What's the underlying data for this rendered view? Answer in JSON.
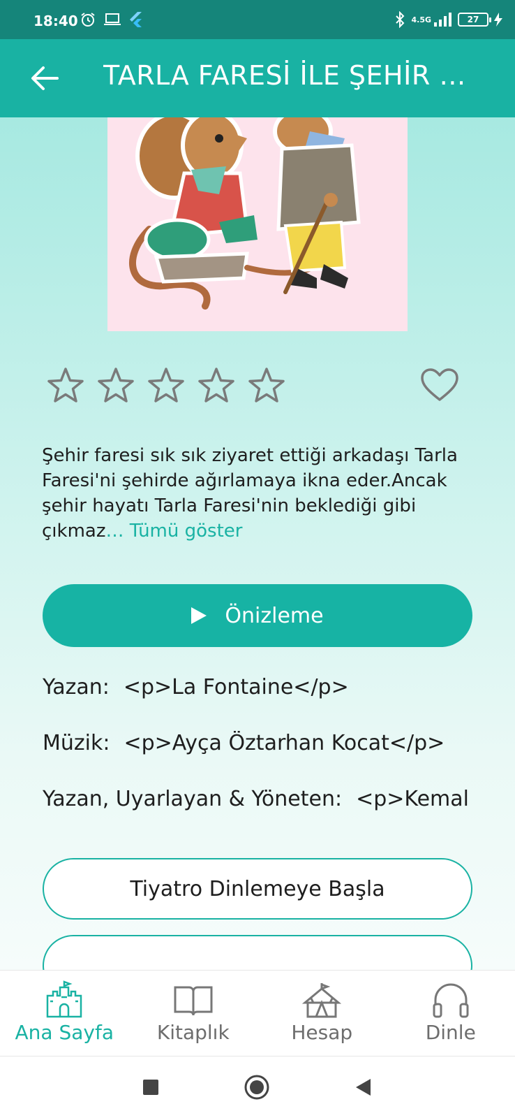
{
  "status_bar": {
    "time": "18:40",
    "battery": "27",
    "network": "4.5G"
  },
  "app_bar": {
    "title": "TARLA FARESİ İLE ŞEHİR …"
  },
  "book": {
    "rating": 0,
    "rating_max": 5,
    "favorited": false,
    "description": "Şehir faresi sık sık ziyaret ettiği arkadaşı Tarla Faresi'ni şehirde ağırlamaya ikna eder.Ancak şehir hayatı Tarla Faresi'nin beklediği gibi çıkmaz",
    "show_more": "… Tümü göster",
    "preview_label": "Önizleme",
    "credits": [
      {
        "label": "Yazan:",
        "value": "<p>La Fontaine</p>"
      },
      {
        "label": "Müzik:",
        "value": "<p>Ayça Öztarhan Kocat</p>"
      },
      {
        "label": "Yazan, Uyarlayan & Yöneten:",
        "value": "<p>Kemal Kc"
      }
    ],
    "listen_label": "Tiyatro Dinlemeye Başla"
  },
  "bottom_nav": {
    "items": [
      {
        "label": "Ana Sayfa",
        "icon": "castle-icon",
        "active": true
      },
      {
        "label": "Kitaplık",
        "icon": "book-icon",
        "active": false
      },
      {
        "label": "Hesap",
        "icon": "circus-tent-icon",
        "active": false
      },
      {
        "label": "Dinle",
        "icon": "headphones-icon",
        "active": false
      }
    ]
  },
  "colors": {
    "primary": "#19b2a3",
    "status_bar": "#15857a"
  }
}
